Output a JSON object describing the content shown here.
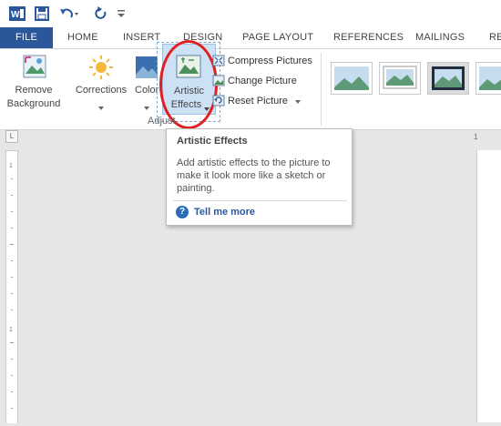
{
  "tabs": [
    "FILE",
    "HOME",
    "INSERT",
    "DESIGN",
    "PAGE LAYOUT",
    "REFERENCES",
    "MAILINGS",
    "REV"
  ],
  "ribbon": {
    "remove_background": [
      "Remove",
      "Background"
    ],
    "corrections": "Corrections",
    "color": "Color",
    "artistic_effects": [
      "Artistic",
      "Effects"
    ],
    "compress_pictures": "Compress Pictures",
    "change_picture": "Change Picture",
    "reset_picture": "Reset Picture",
    "group_label": "Adjust"
  },
  "tooltip": {
    "title": "Artistic Effects",
    "body": "Add artistic effects to the picture to make it look more like a sketch or painting.",
    "link": "Tell me more"
  },
  "ruler": {
    "corner": "L",
    "top_marker": "1"
  },
  "colors": {
    "file_tab": "#2b579a",
    "word_blue": "#2b579a",
    "highlight_circle": "#e02020"
  },
  "icons": [
    "word-logo-icon",
    "save-icon",
    "undo-icon",
    "redo-icon",
    "customize-qat-icon",
    "help-icon"
  ]
}
